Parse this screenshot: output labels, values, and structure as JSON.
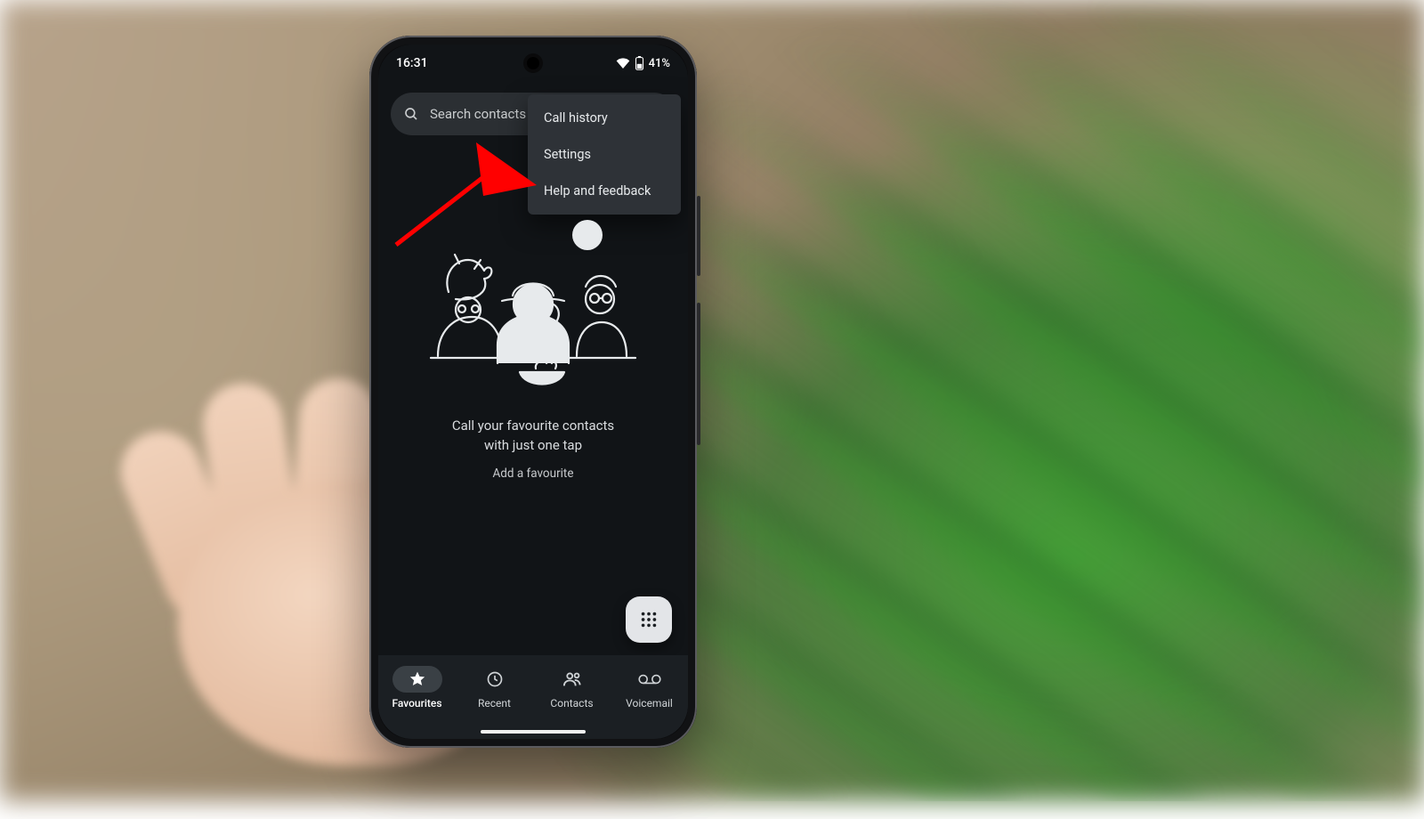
{
  "statusbar": {
    "time": "16:31",
    "battery_text": "41%"
  },
  "search": {
    "placeholder": "Search contacts"
  },
  "menu": {
    "items": [
      {
        "label": "Call history"
      },
      {
        "label": "Settings"
      },
      {
        "label": "Help and feedback"
      }
    ]
  },
  "empty_state": {
    "line1": "Call your favourite contacts",
    "line2": "with just one tap",
    "action": "Add a favourite"
  },
  "nav": {
    "items": [
      {
        "label": "Favourites",
        "active": true
      },
      {
        "label": "Recent",
        "active": false
      },
      {
        "label": "Contacts",
        "active": false
      },
      {
        "label": "Voicemail",
        "active": false
      }
    ]
  },
  "annotation": {
    "arrow_color": "#ff0000"
  }
}
